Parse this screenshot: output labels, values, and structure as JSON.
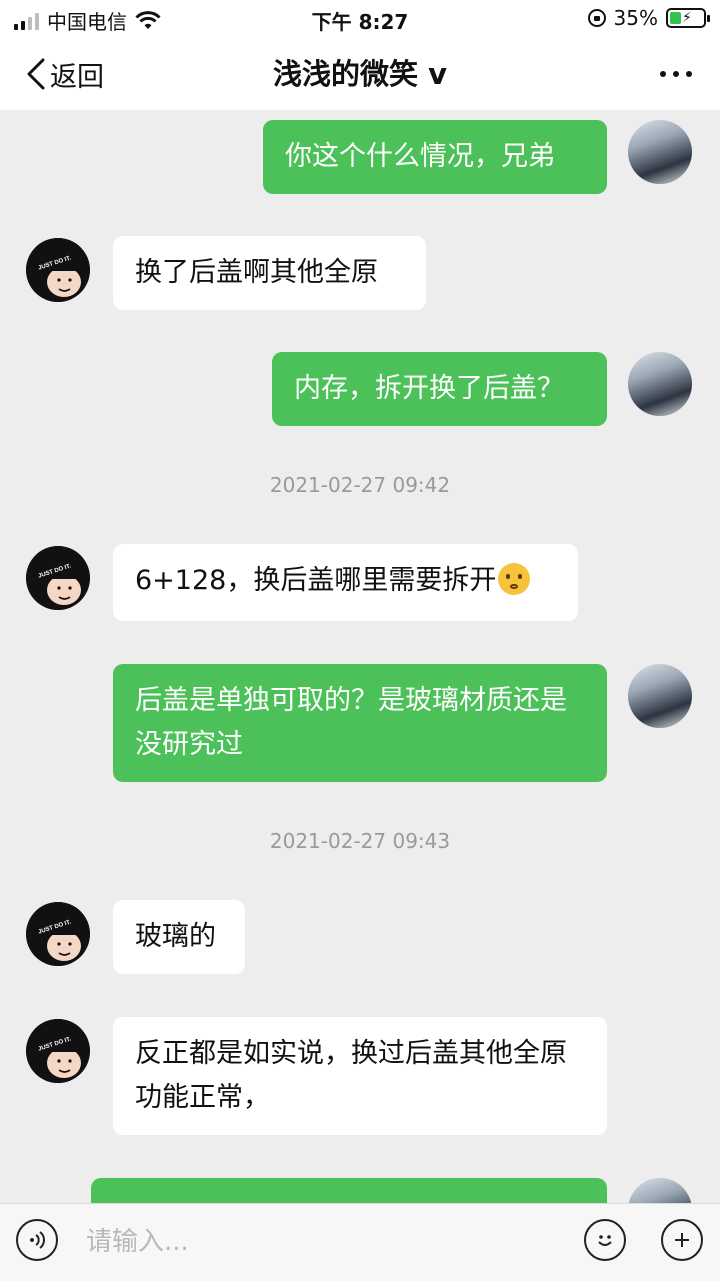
{
  "status_bar": {
    "carrier": "中国电信",
    "time": "下午 8:27",
    "battery": "35%",
    "battery_level": 0.35
  },
  "nav": {
    "back_label": "返回",
    "title": "浅浅的微笑 v",
    "more_icon": "more-dots-icon"
  },
  "messages": [
    {
      "from": "me",
      "text": "你这个什么情况，兄弟"
    },
    {
      "from": "them",
      "text": "换了后盖啊其他全原"
    },
    {
      "from": "me",
      "text": "内存，拆开换了后盖？"
    },
    {
      "type": "timestamp",
      "text": "2021-02-27 09:42"
    },
    {
      "from": "them",
      "text": "6+128，换后盖哪里需要拆开",
      "emoji": "thinking-face-emoji"
    },
    {
      "from": "me",
      "text": "后盖是单独可取的？是玻璃材质还是没研究过"
    },
    {
      "type": "timestamp",
      "text": "2021-02-27 09:43"
    },
    {
      "from": "them",
      "text": "玻璃的"
    },
    {
      "from": "them",
      "text": "反正都是如实说，换过后盖其他全原功能正常，"
    }
  ],
  "avatar_them": {
    "badge_text": "JUST DO IT."
  },
  "input_bar": {
    "placeholder": "请输入...",
    "voice_icon": "voice-icon",
    "emoji_icon": "emoji-icon",
    "add_icon": "plus-icon"
  },
  "colors": {
    "my_bubble": "#4cc159",
    "their_bubble": "#ffffff",
    "background": "#ededed"
  }
}
